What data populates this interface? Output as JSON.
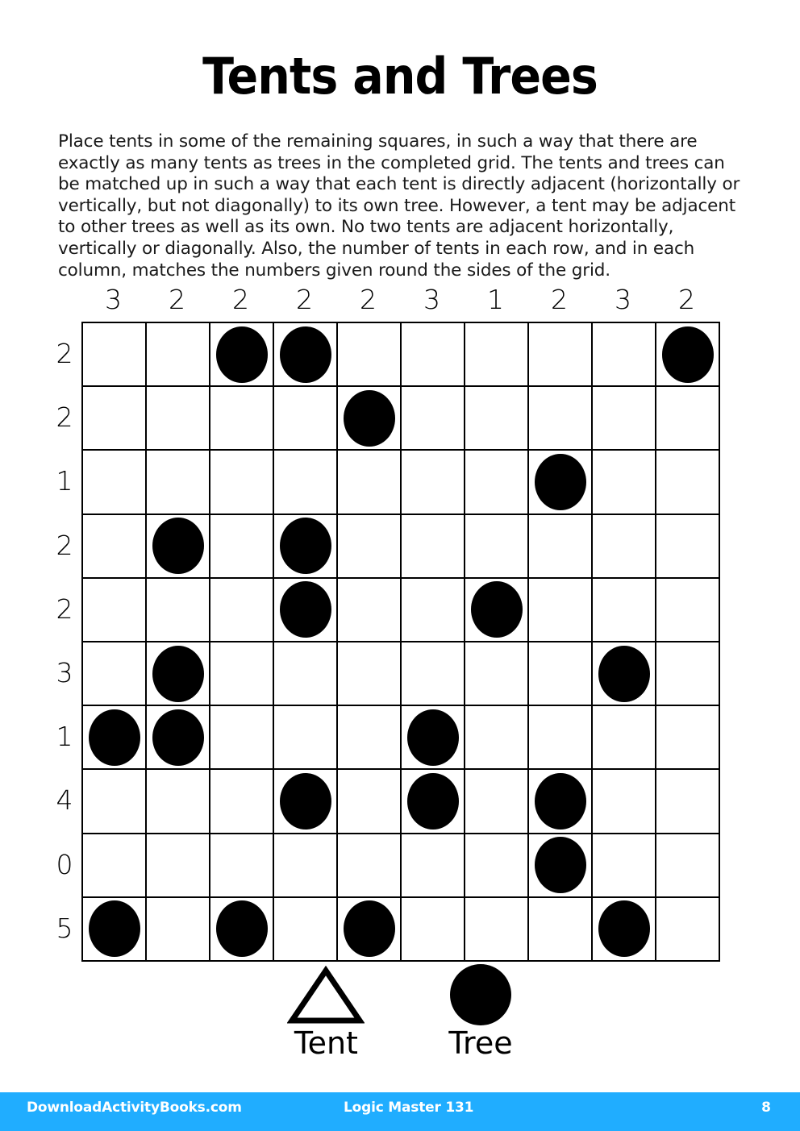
{
  "page": {
    "title": "Tents and Trees",
    "instructions": "Place tents in some of the remaining squares, in such a way that there are exactly as many tents as trees in the completed grid. The tents and trees can be matched up in such a way that each tent is directly adjacent (horizontally or vertically, but not diagonally) to its own tree. However, a tent may be adjacent to other trees as well as its own. No two tents are adjacent horizontally, vertically or diagonally. Also, the number of tents in each row, and in each column, matches the numbers given round the sides of the grid.",
    "background_color": "#ffffff",
    "ink_color": "#000000"
  },
  "puzzle": {
    "type": "tents-and-trees",
    "rows": 10,
    "columns": 10,
    "column_clues": [
      3,
      2,
      2,
      2,
      2,
      3,
      1,
      2,
      3,
      2
    ],
    "row_clues": [
      2,
      2,
      1,
      2,
      2,
      3,
      1,
      4,
      0,
      5
    ],
    "tree_positions": [
      {
        "row": 1,
        "col": 3
      },
      {
        "row": 1,
        "col": 4
      },
      {
        "row": 1,
        "col": 10
      },
      {
        "row": 2,
        "col": 5
      },
      {
        "row": 3,
        "col": 8
      },
      {
        "row": 4,
        "col": 2
      },
      {
        "row": 4,
        "col": 4
      },
      {
        "row": 5,
        "col": 4
      },
      {
        "row": 5,
        "col": 7
      },
      {
        "row": 6,
        "col": 2
      },
      {
        "row": 6,
        "col": 9
      },
      {
        "row": 7,
        "col": 1
      },
      {
        "row": 7,
        "col": 2
      },
      {
        "row": 7,
        "col": 6
      },
      {
        "row": 8,
        "col": 4
      },
      {
        "row": 8,
        "col": 6
      },
      {
        "row": 8,
        "col": 8
      },
      {
        "row": 9,
        "col": 8
      },
      {
        "row": 10,
        "col": 1
      },
      {
        "row": 10,
        "col": 3
      },
      {
        "row": 10,
        "col": 5
      },
      {
        "row": 10,
        "col": 9
      }
    ],
    "grid": [
      [
        0,
        0,
        1,
        1,
        0,
        0,
        0,
        0,
        0,
        1
      ],
      [
        0,
        0,
        0,
        0,
        1,
        0,
        0,
        0,
        0,
        0
      ],
      [
        0,
        0,
        0,
        0,
        0,
        0,
        0,
        1,
        0,
        0
      ],
      [
        0,
        1,
        0,
        1,
        0,
        0,
        0,
        0,
        0,
        0
      ],
      [
        0,
        0,
        0,
        1,
        0,
        0,
        1,
        0,
        0,
        0
      ],
      [
        0,
        1,
        0,
        0,
        0,
        0,
        0,
        0,
        1,
        0
      ],
      [
        1,
        1,
        0,
        0,
        0,
        1,
        0,
        0,
        0,
        0
      ],
      [
        0,
        0,
        0,
        1,
        0,
        1,
        0,
        1,
        0,
        0
      ],
      [
        0,
        0,
        0,
        0,
        0,
        0,
        0,
        1,
        0,
        0
      ],
      [
        1,
        0,
        1,
        0,
        1,
        0,
        0,
        0,
        1,
        0
      ]
    ]
  },
  "legend": {
    "tent": {
      "label": "Tent",
      "glyph": "triangle-outline"
    },
    "tree": {
      "label": "Tree",
      "glyph": "filled-circle"
    }
  },
  "footer": {
    "site": "DownloadActivityBooks.com",
    "book": "Logic Master 131",
    "page_number": "8",
    "background_color": "#20adff",
    "text_color": "#ffffff"
  }
}
